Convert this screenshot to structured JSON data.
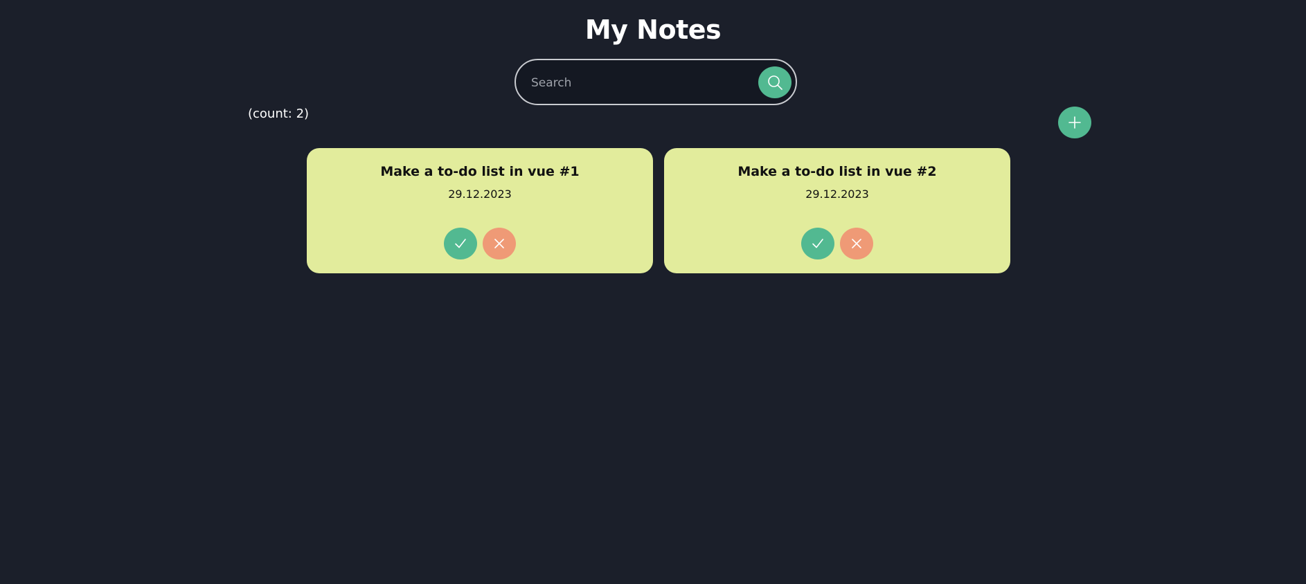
{
  "header": {
    "title": "My Notes"
  },
  "search": {
    "placeholder": "Search",
    "value": "",
    "icon": "search-icon"
  },
  "toolbar": {
    "count_text": "(count: 2)",
    "add_icon": "plus-icon"
  },
  "notes": [
    {
      "title": "Make a to-do list in vue #1",
      "date": "29.12.2023",
      "done_icon": "check-icon",
      "delete_icon": "close-icon"
    },
    {
      "title": "Make a to-do list in vue #2",
      "date": "29.12.2023",
      "done_icon": "check-icon",
      "delete_icon": "close-icon"
    }
  ],
  "colors": {
    "background": "#1b1f2a",
    "accent": "#52b991",
    "danger": "#ef9a76",
    "card": "#e2ec9c"
  }
}
